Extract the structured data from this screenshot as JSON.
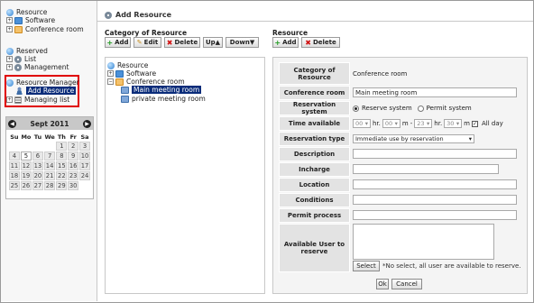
{
  "sidebar": {
    "resource_root": "Resource",
    "software": "Software",
    "conference_room": "Conference room",
    "reserved_root": "Reserved",
    "reserved_list": "List",
    "reserved_management": "Management",
    "manager_root": "Resource Manager",
    "add_resource": "Add Resource",
    "managing_list": "Managing list"
  },
  "calendar": {
    "month_label": "Sept 2011",
    "weekdays": [
      "Su",
      "Mo",
      "Tu",
      "We",
      "Th",
      "Fr",
      "Sa"
    ],
    "weeks": [
      [
        "",
        "",
        "",
        "",
        "1",
        "2",
        "3"
      ],
      [
        "4",
        "5",
        "6",
        "7",
        "8",
        "9",
        "10"
      ],
      [
        "11",
        "12",
        "13",
        "14",
        "15",
        "16",
        "17"
      ],
      [
        "18",
        "19",
        "20",
        "21",
        "22",
        "23",
        "24"
      ],
      [
        "25",
        "26",
        "27",
        "28",
        "29",
        "30",
        ""
      ]
    ],
    "today": "5"
  },
  "header": {
    "title": "Add Resource"
  },
  "category": {
    "title": "Category of Resource",
    "buttons": {
      "add": "Add",
      "edit": "Edit",
      "delete": "Delete",
      "up": "Up▲",
      "down": "Down▼"
    },
    "tree": {
      "root": "Resource",
      "software": "Software",
      "conference_room": "Conference room",
      "main_meeting_room": "Main meeting room",
      "private_meeting_room": "private meeting room"
    }
  },
  "resource": {
    "title": "Resource",
    "buttons": {
      "add": "Add",
      "delete": "Delete"
    }
  },
  "form": {
    "category_label": "Category of Resource",
    "category_value": "Conference room",
    "conference_room_label": "Conference room",
    "conference_room_value": "Main meeting room",
    "reservation_system_label": "Reservation system",
    "reservation_system_option1": "Reserve system",
    "reservation_system_option2": "Permit system",
    "time_available_label": "Time available",
    "time_start_hr": "00",
    "time_start_min": "00",
    "time_end_hr": "23",
    "time_end_min": "30",
    "hr_unit": "hr.",
    "m_unit": "m",
    "dash": "-",
    "all_day_label": "All day",
    "reservation_type_label": "Reservation type",
    "reservation_type_value": "Immediate use by reservation",
    "description_label": "Description",
    "incharge_label": "Incharge",
    "location_label": "Location",
    "conditions_label": "Conditions",
    "permit_process_label": "Permit process",
    "available_user_label": "Available User to reserve",
    "select_button": "Select",
    "select_note": "*No select, all user are available to reserve.",
    "ok_button": "Ok",
    "cancel_button": "Cancel"
  }
}
